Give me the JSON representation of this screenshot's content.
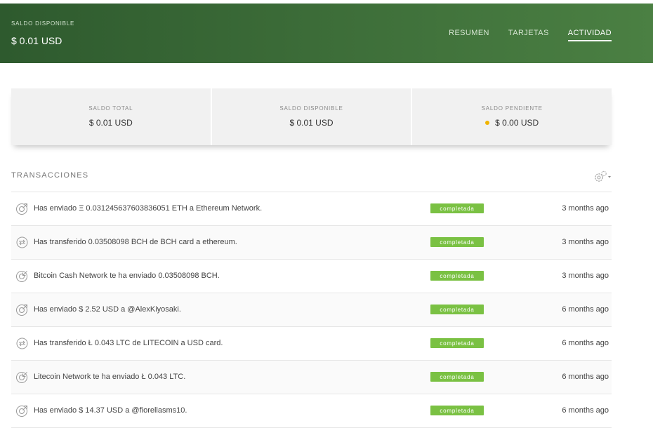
{
  "header": {
    "balance_label": "SALDO DISPONIBLE",
    "balance_value": "$ 0.01 USD",
    "tabs": [
      {
        "label": "RESUMEN",
        "active": false
      },
      {
        "label": "TARJETAS",
        "active": false
      },
      {
        "label": "ACTIVIDAD",
        "active": true
      }
    ],
    "colors": {
      "gradient_start": "#2e5a2e",
      "gradient_end": "#4b8043"
    }
  },
  "summary": {
    "cards": [
      {
        "label": "SALDO TOTAL",
        "value": "$ 0.01 USD"
      },
      {
        "label": "SALDO DISPONIBLE",
        "value": "$ 0.01 USD"
      },
      {
        "label": "SALDO PENDIENTE",
        "value": "$ 0.00 USD",
        "status_dot_color": "#f0b400"
      }
    ]
  },
  "transactions": {
    "title": "TRANSACCIONES",
    "settings_icon": "gear-icon",
    "status_color": "#7ac143",
    "rows": [
      {
        "icon": "send-icon",
        "description": "Has enviado Ξ 0.031245637603836051 ETH a Ethereum Network.",
        "status": "completada",
        "time": "3 months ago"
      },
      {
        "icon": "transfer-icon",
        "description": "Has transferido 0.03508098 BCH de BCH card a ethereum.",
        "status": "completada",
        "time": "3 months ago"
      },
      {
        "icon": "receive-icon",
        "description": "Bitcoin Cash Network te ha enviado 0.03508098 BCH.",
        "status": "completada",
        "time": "3 months ago"
      },
      {
        "icon": "send-icon",
        "description": "Has enviado $ 2.52 USD a @AlexKiyosaki.",
        "status": "completada",
        "time": "6 months ago"
      },
      {
        "icon": "transfer-icon",
        "description": "Has transferido Ł 0.043 LTC de LITECOIN a USD card.",
        "status": "completada",
        "time": "6 months ago"
      },
      {
        "icon": "receive-icon",
        "description": "Litecoin Network te ha enviado Ł 0.043 LTC.",
        "status": "completada",
        "time": "6 months ago"
      },
      {
        "icon": "send-icon",
        "description": "Has enviado $ 14.37 USD a @fiorellasms10.",
        "status": "completada",
        "time": "6 months ago"
      }
    ]
  }
}
